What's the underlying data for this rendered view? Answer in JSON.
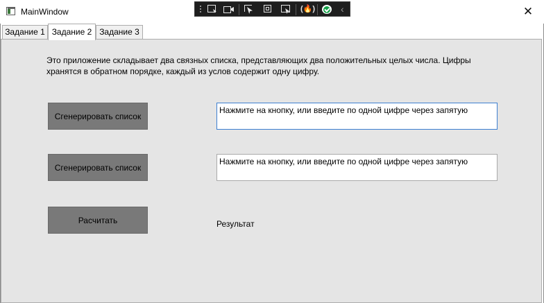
{
  "window": {
    "title": "MainWindow",
    "close_glyph": "✕",
    "icon": "app-window-icon"
  },
  "dev_toolbar": {
    "icons": [
      "select-element-icon",
      "live-visual-tree-icon",
      "display-layout-adorners-icon",
      "track-focus-icon",
      "preview-selection-icon",
      "hot-reload-icon",
      "hot-reload-status-icon",
      "collapse-chevron-icon"
    ],
    "hot_reload_glyph": "(🔥)",
    "collapse_glyph": "‹"
  },
  "tabs": [
    {
      "label": "Задание 1",
      "selected": false
    },
    {
      "label": "Задание 2",
      "selected": true
    },
    {
      "label": "Задание 3",
      "selected": false
    }
  ],
  "main": {
    "description": "Это приложение складывает два связных списка, представляющих два положительных целых числа.  Цифры хранятся в обратном порядке, каждый из услов содержит одну цифру.",
    "generate_button_1": "Сгенерировать список",
    "generate_button_2": "Сгенерировать список",
    "input_1_value": "Нажмите на кнопку, или введите по одной цифре через запятую",
    "input_2_value": "Нажмите на кнопку, или введите по одной цифре через запятую",
    "calculate_button": "Расчитать",
    "result_label": "Результат"
  },
  "colors": {
    "content_bg": "#e5e5e5",
    "button_bg": "#797979",
    "focus_border": "#3b7fd1"
  }
}
